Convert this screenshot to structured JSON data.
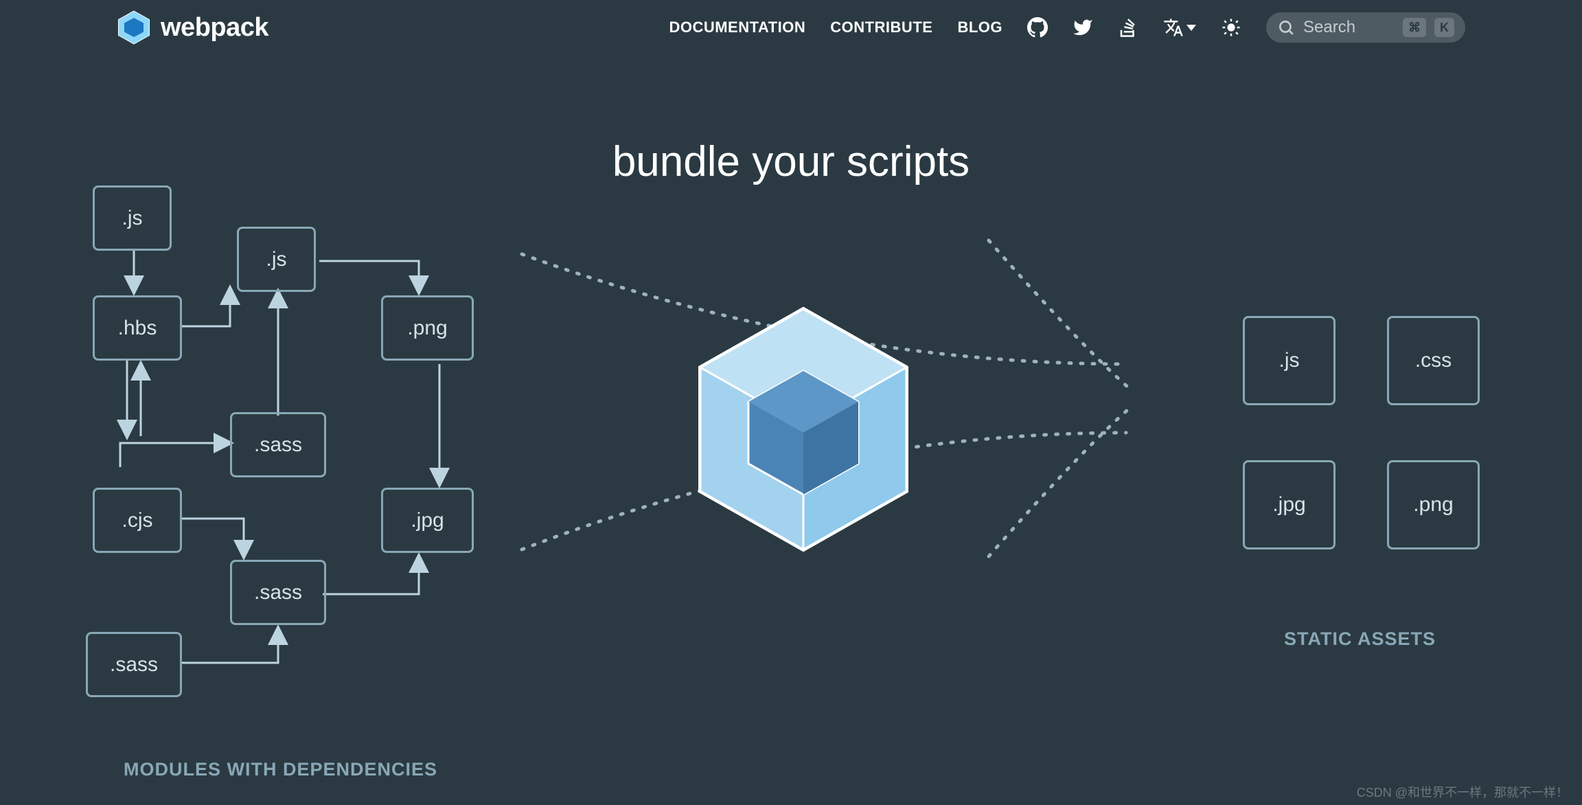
{
  "brand": {
    "name": "webpack"
  },
  "nav": {
    "documentation": "DOCUMENTATION",
    "contribute": "CONTRIBUTE",
    "blog": "BLOG"
  },
  "search": {
    "placeholder": "Search",
    "kbd1": "⌘",
    "kbd2": "K"
  },
  "hero": {
    "title": "bundle your scripts"
  },
  "modules": {
    "caption": "MODULES WITH DEPENDENCIES",
    "files": [
      {
        "id": "js1",
        "label": ".js"
      },
      {
        "id": "js2",
        "label": ".js"
      },
      {
        "id": "hbs",
        "label": ".hbs"
      },
      {
        "id": "png",
        "label": ".png"
      },
      {
        "id": "sass1",
        "label": ".sass"
      },
      {
        "id": "cjs",
        "label": ".cjs"
      },
      {
        "id": "jpg",
        "label": ".jpg"
      },
      {
        "id": "sass2",
        "label": ".sass"
      },
      {
        "id": "sass3",
        "label": ".sass"
      }
    ]
  },
  "assets": {
    "caption": "STATIC ASSETS",
    "files": [
      {
        "id": "out-js",
        "label": ".js"
      },
      {
        "id": "out-css",
        "label": ".css"
      },
      {
        "id": "out-jpg",
        "label": ".jpg"
      },
      {
        "id": "out-png",
        "label": ".png"
      }
    ]
  },
  "watermark": "CSDN @和世界不一样，那就不一样！"
}
